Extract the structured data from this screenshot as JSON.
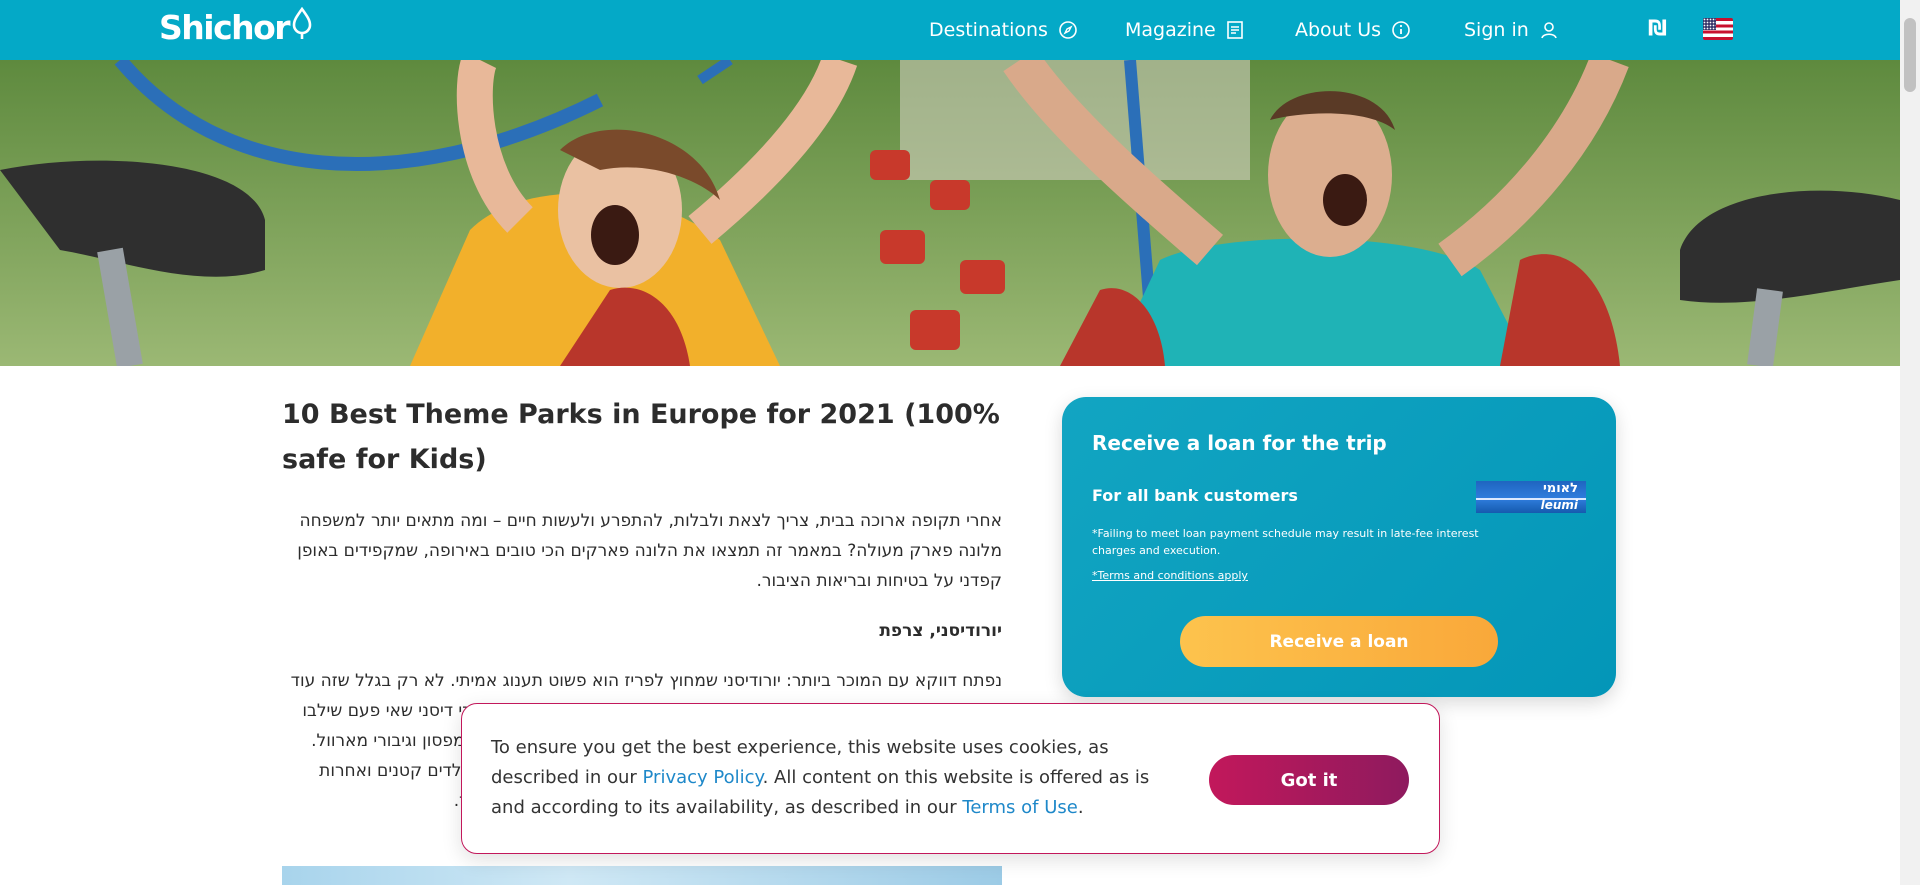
{
  "header": {
    "logo_text": "Shichor",
    "nav": {
      "destinations": "Destinations",
      "magazine": "Magazine",
      "about": "About Us",
      "sign_in": "Sign in"
    },
    "currency": "₪",
    "icons": {
      "destinations": "compass-icon",
      "magazine": "document-icon",
      "about": "info-icon",
      "sign_in": "user-icon",
      "language": "us-flag-icon"
    }
  },
  "article": {
    "title": "10 Best Theme Parks in Europe for 2021 (100% safe for Kids)",
    "intro": "אחרי תקופה ארוכה בבית, צריך לצאת ולבלות, להתפרע ולעשות חיים – ומה מתאים יותר למשפחה מלונה פארק מעולה? במאמר זה תמצאו את הלונה פארקים הכי טובים באירופה, שמקפידים באופן קפדני על בטיחות ובריאות הציבור.",
    "subhead": "יורודיסני, צרפת",
    "paragraph2": "נפתח דווקא עם המוכר ביותר: יורודיסני שמחוץ לפריז הוא פשוט תענוג אמיתי. לא רק בגלל שזה עוד פארק של דיסני – אלא גם בגלל שהפארק הזה מיוחד: כאן הצטרפו כל כוכבי דיסני שאי פעם שילבו את כל הדמויות האהובות, ועולם שלם של הרפתקאות ושאר כמו משפחת סימפסון וגיבורי מארוול. בפארק תמצאו גם מתקנים לכל הגילאים, הרים מדהימות שחלקן מיועדות לילדים קטנים ואחרות להרפתקנים, מתקני מים, רכבות הרים, סרטים, מופעים כיפיים, מסעדות ועוד."
  },
  "loan": {
    "title": "Receive a loan for the trip",
    "subtitle": "For all bank customers",
    "note": "*Failing to meet loan payment schedule may result in late-fee interest charges and execution.",
    "terms": "*Terms and conditions apply",
    "bank_he": "לאומי",
    "bank_en": "leumi",
    "button": "Receive a loan"
  },
  "cookie": {
    "text_1": "To ensure you get the best experience, this website uses cookies, as described in our ",
    "privacy_link": "Privacy Policy",
    "text_2": ". All content on this website is offered as is and according to its availability, as described in our ",
    "terms_link": "Terms of Use",
    "text_3": ".",
    "button": "Got it"
  },
  "colors": {
    "header": "#04a9c7",
    "loan_card": "#0396b8",
    "loan_button": "#f9a83a",
    "cookie_button": "#c2185b",
    "link": "#1e88c9"
  }
}
